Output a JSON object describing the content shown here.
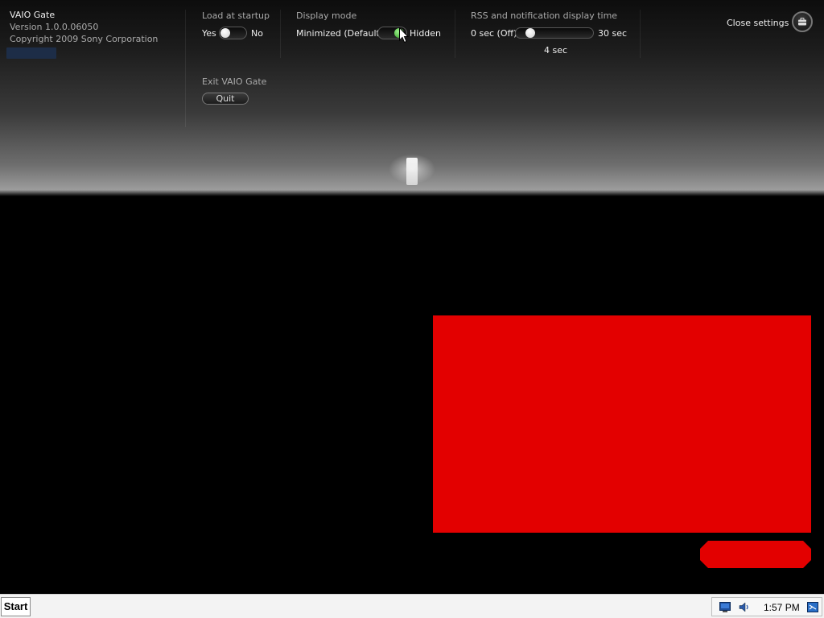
{
  "app": {
    "name": "VAIO Gate",
    "version": "Version 1.0.0.06050",
    "copyright": "Copyright 2009 Sony Corporation"
  },
  "settings": {
    "load_at_startup": {
      "label": "Load at startup",
      "option_on": "Yes",
      "option_off": "No",
      "selected": "Yes"
    },
    "display_mode": {
      "label": "Display mode",
      "option_left": "Minimized (Default)",
      "option_right": "Hidden",
      "selected": "Hidden"
    },
    "rss_time": {
      "label": "RSS and notification display time",
      "min_label": "0 sec (Off)",
      "max_label": "30 sec",
      "value_label": "4 sec",
      "value": 4,
      "min": 0,
      "max": 30
    },
    "exit": {
      "label": "Exit VAIO Gate",
      "button_label": "Quit"
    },
    "close": {
      "label": "Close settings",
      "icon": "briefcase-icon"
    }
  },
  "colors": {
    "red": "#e30000",
    "toggle_on": "#2f9a22"
  },
  "taskbar": {
    "start_label": "Start",
    "clock": "1:57 PM",
    "tray_icons": [
      "monitor-icon",
      "speaker-icon",
      "network-icon"
    ]
  }
}
